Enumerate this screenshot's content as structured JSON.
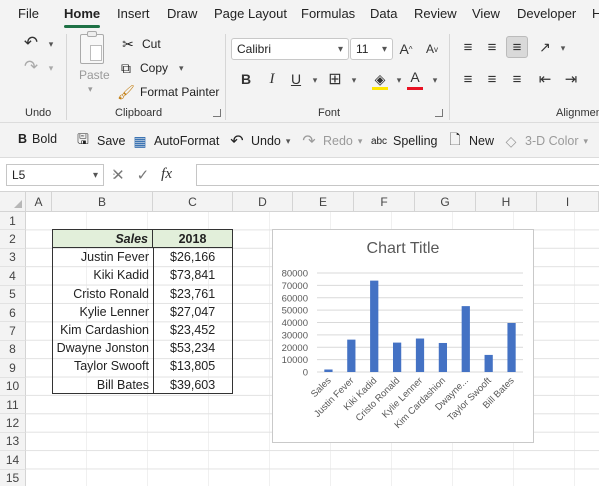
{
  "menu": {
    "tabs": [
      "File",
      "Home",
      "Insert",
      "Draw",
      "Page Layout",
      "Formulas",
      "Data",
      "Review",
      "View",
      "Developer",
      "H"
    ],
    "active": "Home"
  },
  "ribbon": {
    "undo_group": "Undo",
    "clipboard": {
      "paste": "Paste",
      "cut": "Cut",
      "copy": "Copy",
      "format_painter": "Format Painter",
      "label": "Clipboard"
    },
    "font": {
      "name": "Calibri",
      "size": "11",
      "bold": "B",
      "italic": "I",
      "underline": "U",
      "font_color_letter": "A",
      "grow": "A",
      "shrink": "A",
      "label": "Font"
    },
    "alignment_label": "Alignmen"
  },
  "toolbar": {
    "bold": "Bold",
    "save": "Save",
    "autoformat": "AutoFormat",
    "undo": "Undo",
    "redo": "Redo",
    "spelling": "Spelling",
    "new": "New",
    "three_d_color": "3-D Color"
  },
  "formula_bar": {
    "name_box": "L5",
    "fx": "fx",
    "formula": ""
  },
  "columns": [
    "A",
    "B",
    "C",
    "D",
    "E",
    "F",
    "G",
    "H",
    "I"
  ],
  "rows": [
    "1",
    "2",
    "3",
    "4",
    "5",
    "6",
    "7",
    "8",
    "9",
    "10",
    "11",
    "12",
    "13",
    "14",
    "15"
  ],
  "table": {
    "header": {
      "name": "Sales",
      "year": "2018"
    },
    "rows": [
      {
        "name": "Justin Fever",
        "value": "$26,166"
      },
      {
        "name": "Kiki Kadid",
        "value": "$73,841"
      },
      {
        "name": "Cristo Ronald",
        "value": "$23,761"
      },
      {
        "name": "Kylie Lenner",
        "value": "$27,047"
      },
      {
        "name": "Kim Cardashion",
        "value": "$23,452"
      },
      {
        "name": "Dwayne Jonston",
        "value": "$53,234"
      },
      {
        "name": "Taylor Swooft",
        "value": "$13,805"
      },
      {
        "name": "Bill Bates",
        "value": "$39,603"
      }
    ]
  },
  "colors": {
    "accent": "#1e7145",
    "bar": "#4472c4",
    "header_fill": "#e2efda",
    "font_red": "#e81123"
  },
  "chart_data": {
    "type": "bar",
    "title": "Chart Title",
    "categories": [
      "Sales",
      "Justin Fever",
      "Kiki Kadid",
      "Cristo Ronald",
      "Kylie Lenner",
      "Kim Cardashion",
      "Dwayne...",
      "Taylor Swooft",
      "Bill Bates"
    ],
    "values": [
      2018,
      26166,
      73841,
      23761,
      27047,
      23452,
      53234,
      13805,
      39603
    ],
    "yticks": [
      "0",
      "10000",
      "20000",
      "30000",
      "40000",
      "50000",
      "60000",
      "70000",
      "80000"
    ],
    "ylim": [
      0,
      80000
    ],
    "grid": true,
    "legend": "none"
  }
}
